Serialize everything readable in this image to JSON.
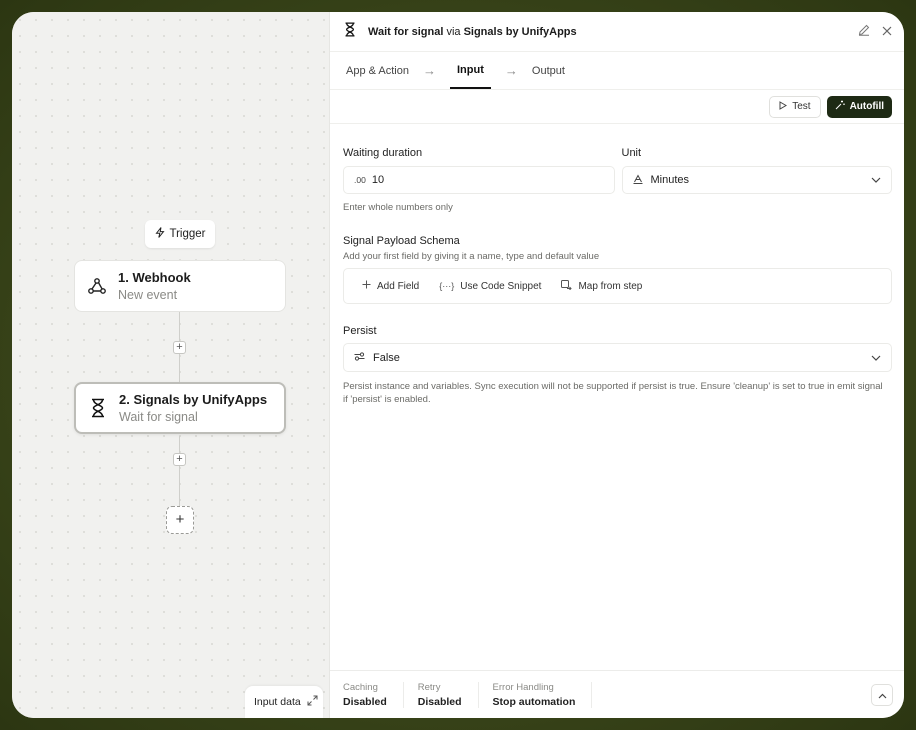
{
  "canvas": {
    "trigger_label": "Trigger",
    "nodes": [
      {
        "title": "1. Webhook",
        "subtitle": "New event"
      },
      {
        "title": "2. Signals by UnifyApps",
        "subtitle": "Wait for signal"
      }
    ],
    "input_data_label": "Input data"
  },
  "panel": {
    "title_action": "Wait for signal",
    "title_via": "via",
    "title_app": "Signals by UnifyApps",
    "tabs": [
      "App & Action",
      "Input",
      "Output"
    ],
    "active_tab": "Input",
    "test_label": "Test",
    "autofill_label": "Autofill"
  },
  "form": {
    "waiting_duration_label": "Waiting duration",
    "waiting_duration_prefix": ".00",
    "waiting_duration_value": "10",
    "waiting_duration_hint": "Enter whole numbers only",
    "unit_label": "Unit",
    "unit_value": "Minutes",
    "schema_label": "Signal Payload Schema",
    "schema_hint": "Add your first field by giving it a name, type and default value",
    "add_field": "Add Field",
    "use_code_snippet": "Use Code Snippet",
    "map_from_step": "Map from step",
    "persist_label": "Persist",
    "persist_value": "False",
    "persist_hint": "Persist instance and variables. Sync execution will not be supported if persist is true. Ensure 'cleanup' is set to true in emit signal if 'persist' is enabled."
  },
  "footer": {
    "caching_label": "Caching",
    "caching_value": "Disabled",
    "retry_label": "Retry",
    "retry_value": "Disabled",
    "error_label": "Error Handling",
    "error_value": "Stop automation"
  },
  "colors": {
    "outer_bg": "#3d4a1e",
    "autofill_bg": "#1e2a14"
  }
}
